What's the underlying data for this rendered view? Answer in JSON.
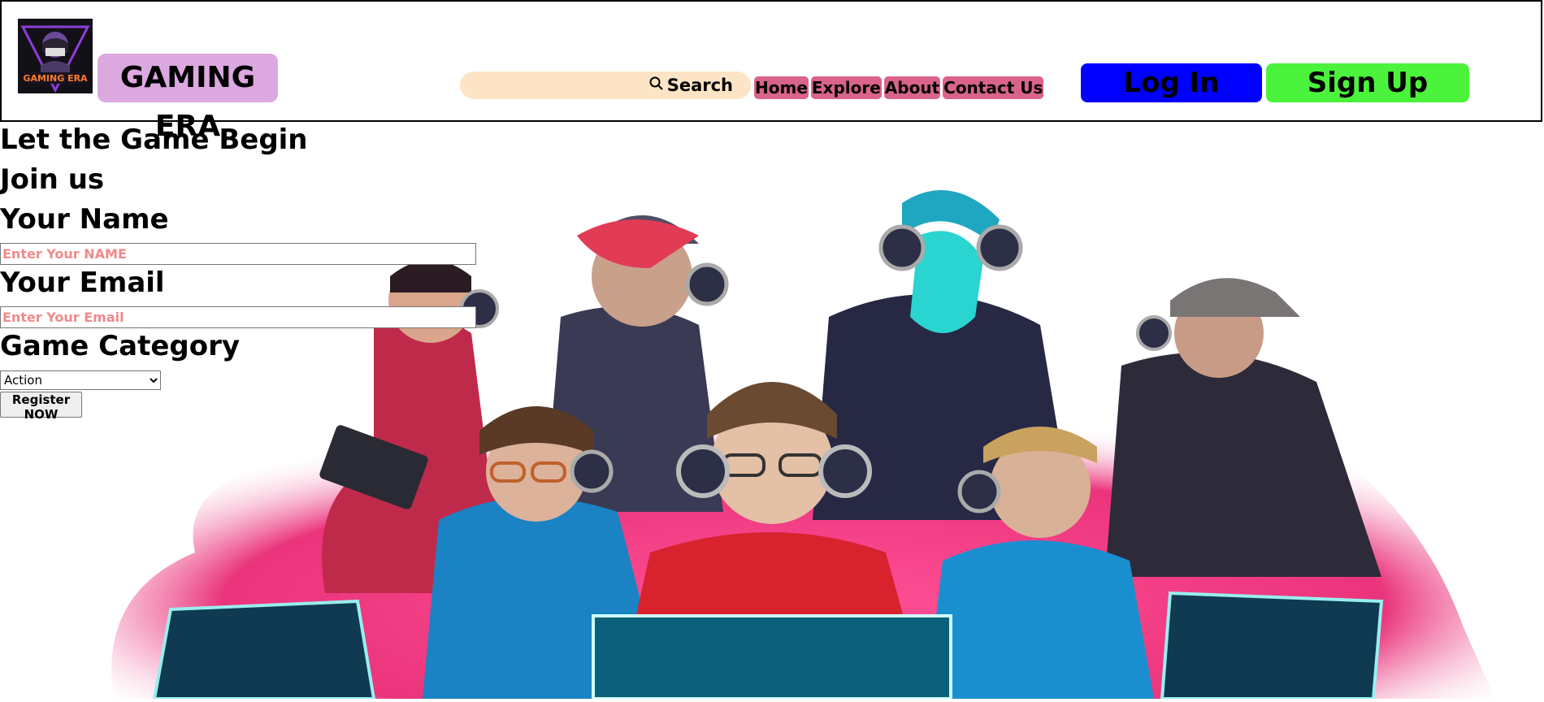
{
  "brand": {
    "name": "GAMING ERA",
    "logo_text": "GAMING ERA"
  },
  "search": {
    "placeholder": "",
    "button_label": "Search",
    "icon": "search-icon"
  },
  "nav": {
    "items": [
      "Home",
      "Explore",
      "About",
      "Contact Us"
    ]
  },
  "auth": {
    "login_label": "Log In",
    "signup_label": "Sign Up"
  },
  "form": {
    "headline": "Let the Game Begin",
    "subheadline": "Join us",
    "name_label": "Your Name",
    "name_placeholder": "Enter Your NAME",
    "email_label": "Your Email",
    "email_placeholder": "Enter Your Email",
    "category_label": "Game Category",
    "category_selected": "Action",
    "submit_label": "Register NOW"
  },
  "colors": {
    "brand_bg": "#dca8e0",
    "search_bg": "#fde4c4",
    "nav_bg": "#d9638c",
    "login_bg": "#0000ff",
    "signup_bg": "#4cf33d",
    "placeholder": "#f08a8a"
  },
  "hero": {
    "image": "gamers-illustration"
  }
}
